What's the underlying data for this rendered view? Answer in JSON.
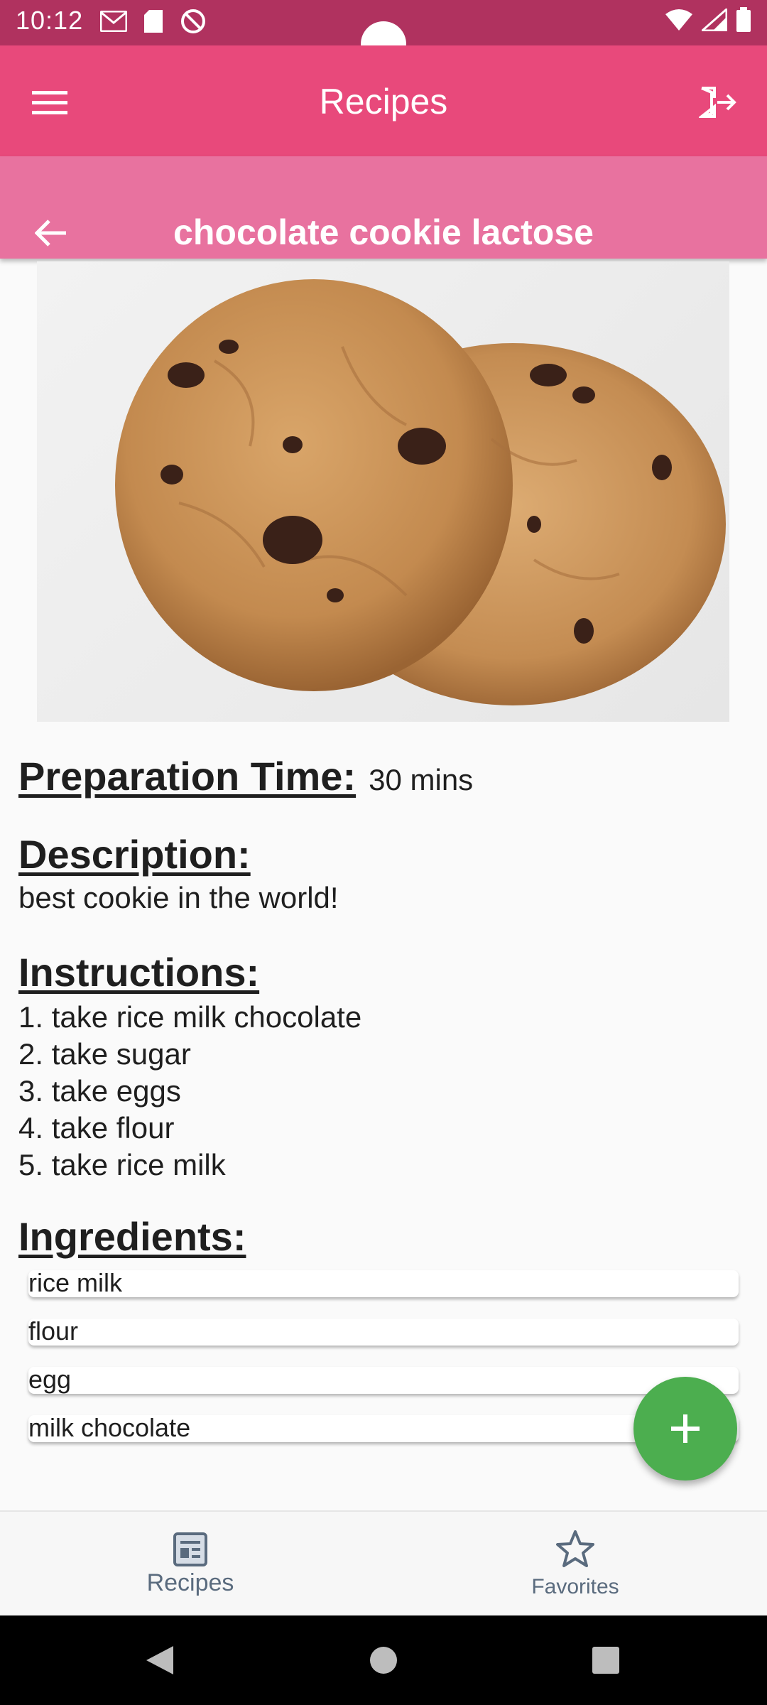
{
  "status_bar": {
    "time": "10:12"
  },
  "app_bar": {
    "title": "Recipes"
  },
  "recipe": {
    "title": "chocolate cookie lactose",
    "prep_time_label": "Preparation Time:",
    "prep_time_value": "30 mins",
    "description_label": "Description:",
    "description": "best cookie in the world!",
    "instructions_label": "Instructions:",
    "instructions": [
      "1. take rice milk chocolate",
      "2. take sugar",
      "3. take eggs",
      "4. take flour",
      "5. take rice milk"
    ],
    "ingredients_label": "Ingredients:",
    "ingredients": [
      "rice milk",
      "flour",
      "egg",
      "milk chocolate"
    ]
  },
  "bottom_nav": {
    "items": [
      {
        "label": "Recipes",
        "icon": "recipes-icon"
      },
      {
        "label": "Favorites",
        "icon": "star-icon"
      }
    ]
  },
  "colors": {
    "status_bar": "#b0325f",
    "app_bar": "#e8497b",
    "sub_header": "#e8729f",
    "fab": "#4cae4f",
    "nav_text": "#5a6b7e"
  }
}
